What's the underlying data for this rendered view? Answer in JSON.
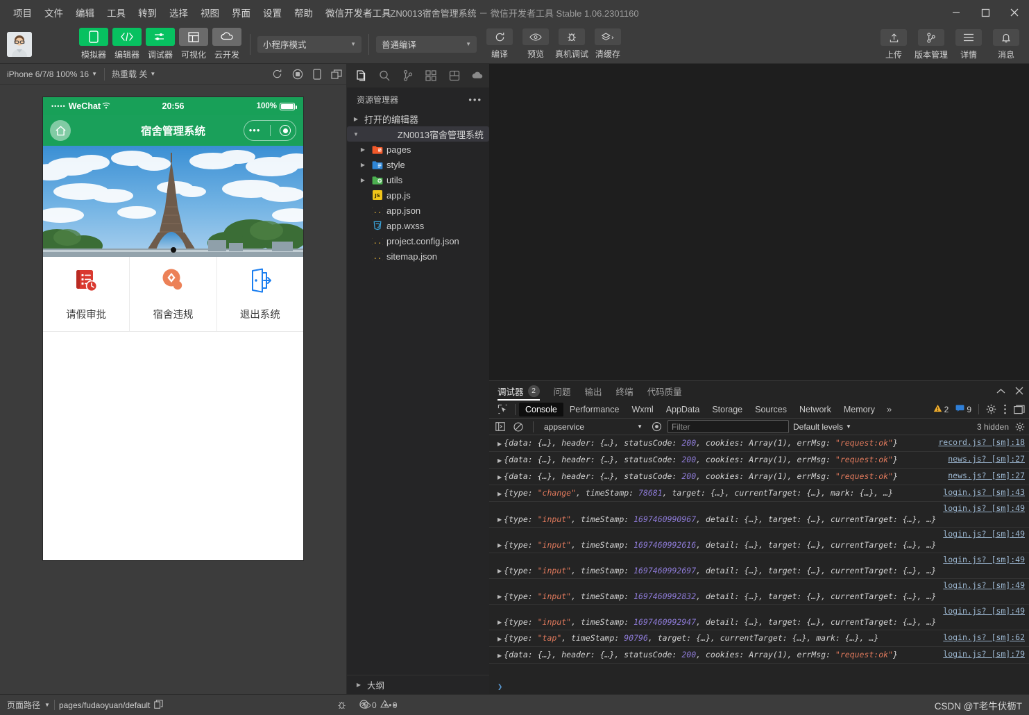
{
  "titlebar": {
    "menus": [
      "项目",
      "文件",
      "编辑",
      "工具",
      "转到",
      "选择",
      "视图",
      "界面",
      "设置",
      "帮助",
      "微信开发者工具"
    ],
    "project_title": "ZN0013宿舍管理系统",
    "title_suffix": "－ 微信开发者工具 Stable 1.06.2301160"
  },
  "toolbar": {
    "mode_buttons": [
      {
        "label": "模拟器",
        "icon": "phone-icon",
        "style": "green"
      },
      {
        "label": "编辑器",
        "icon": "code-icon",
        "style": "green"
      },
      {
        "label": "调试器",
        "icon": "sliders-icon",
        "style": "green"
      },
      {
        "label": "可视化",
        "icon": "layout-icon",
        "style": "grey"
      },
      {
        "label": "云开发",
        "icon": "cloud-icon",
        "style": "grey"
      }
    ],
    "mode_select": "小程序模式",
    "compile_select": "普通编译",
    "action_buttons": [
      {
        "label": "编译",
        "icon": "refresh-icon"
      },
      {
        "label": "预览",
        "icon": "eye-icon"
      },
      {
        "label": "真机调试",
        "icon": "bug-icon"
      },
      {
        "label": "清缓存",
        "icon": "layers-icon"
      }
    ],
    "right_buttons": [
      {
        "label": "上传",
        "icon": "upload-icon"
      },
      {
        "label": "版本管理",
        "icon": "branch-icon"
      },
      {
        "label": "详情",
        "icon": "menu-icon"
      },
      {
        "label": "消息",
        "icon": "bell-icon"
      }
    ]
  },
  "simulator": {
    "device": "iPhone 6/7/8 100% 16",
    "hotreload": "热重载 关",
    "toolbar_icons": [
      "refresh-icon",
      "record-icon",
      "rotate-icon",
      "window-icon"
    ],
    "status": {
      "carrier": "WeChat",
      "signal_dots": "•••••",
      "time": "20:56",
      "battery_pct": "100%"
    },
    "navbar_title": "宿舍管理系统",
    "home_icon": "home-icon",
    "banner_alt": "eiffel-tower-banner",
    "grid": [
      {
        "label": "请假审批",
        "icon": "leave-approval-icon",
        "color": "#d9392f"
      },
      {
        "label": "宿舍违规",
        "icon": "violation-icon",
        "color": "#ec8157"
      },
      {
        "label": "退出系统",
        "icon": "logout-icon",
        "color": "#1a7ef0"
      }
    ]
  },
  "explorer": {
    "activitybar": [
      "files-icon",
      "search-icon",
      "source-control-icon",
      "extensions-icon",
      "debug-icon",
      "cloud-dev-icon"
    ],
    "title": "资源管理器",
    "more": "•••",
    "sections": [
      {
        "label": "打开的编辑器",
        "expanded": false,
        "indent": 0,
        "icon": null
      },
      {
        "label": "ZN0013宿舍管理系统",
        "expanded": true,
        "indent": 0,
        "icon": null,
        "selected": true
      }
    ],
    "files": [
      {
        "label": "pages",
        "icon": "folder-red-icon",
        "type": "folder",
        "expanded": false
      },
      {
        "label": "style",
        "icon": "folder-blue-icon",
        "type": "folder",
        "expanded": false
      },
      {
        "label": "utils",
        "icon": "folder-green-icon",
        "type": "folder",
        "expanded": false
      },
      {
        "label": "app.js",
        "icon": "js-icon",
        "type": "file"
      },
      {
        "label": "app.json",
        "icon": "json-icon",
        "type": "file"
      },
      {
        "label": "app.wxss",
        "icon": "wxss-icon",
        "type": "file"
      },
      {
        "label": "project.config.json",
        "icon": "json-icon",
        "type": "file"
      },
      {
        "label": "sitemap.json",
        "icon": "json-icon",
        "type": "file"
      }
    ],
    "outline": "大纲"
  },
  "devtools": {
    "tabs": [
      {
        "label": "调试器",
        "badge": "2",
        "active": true
      },
      {
        "label": "问题",
        "badge": null,
        "active": false
      },
      {
        "label": "输出",
        "badge": null,
        "active": false
      },
      {
        "label": "终端",
        "badge": null,
        "active": false
      },
      {
        "label": "代码质量",
        "badge": null,
        "active": false
      }
    ],
    "panel_tabs": [
      "Console",
      "Performance",
      "Wxml",
      "AppData",
      "Storage",
      "Sources",
      "Network",
      "Memory"
    ],
    "panel_active": "Console",
    "panel_more": "»",
    "warn_count": "2",
    "info_count": "9",
    "context": "appservice",
    "filter_placeholder": "Filter",
    "levels": "Default levels",
    "hidden": "3 hidden",
    "prompt": "❯",
    "logs": [
      {
        "layout": "single",
        "src": "record.js? [sm]:18",
        "parts": [
          {
            "t": "{data: {…}, header: {…}, statusCode: ",
            "k": "p"
          },
          {
            "t": "200",
            "k": "num"
          },
          {
            "t": ", cookies: Array(1), errMsg: ",
            "k": "p"
          },
          {
            "t": "\"request:ok\"",
            "k": "str"
          },
          {
            "t": "}",
            "k": "p"
          }
        ]
      },
      {
        "layout": "single",
        "src": "news.js? [sm]:27",
        "parts": [
          {
            "t": "{data: {…}, header: {…}, statusCode: ",
            "k": "p"
          },
          {
            "t": "200",
            "k": "num"
          },
          {
            "t": ", cookies: Array(1), errMsg: ",
            "k": "p"
          },
          {
            "t": "\"request:ok\"",
            "k": "str"
          },
          {
            "t": "}",
            "k": "p"
          }
        ]
      },
      {
        "layout": "single",
        "src": "news.js? [sm]:27",
        "parts": [
          {
            "t": "{data: {…}, header: {…}, statusCode: ",
            "k": "p"
          },
          {
            "t": "200",
            "k": "num"
          },
          {
            "t": ", cookies: Array(1), errMsg: ",
            "k": "p"
          },
          {
            "t": "\"request:ok\"",
            "k": "str"
          },
          {
            "t": "}",
            "k": "p"
          }
        ]
      },
      {
        "layout": "single",
        "src": "login.js? [sm]:43",
        "parts": [
          {
            "t": "{type: ",
            "k": "p"
          },
          {
            "t": "\"change\"",
            "k": "str"
          },
          {
            "t": ", timeStamp: ",
            "k": "p"
          },
          {
            "t": "78681",
            "k": "num"
          },
          {
            "t": ", target: {…}, currentTarget: {…}, mark: {…}, …}",
            "k": "p"
          }
        ]
      },
      {
        "layout": "double",
        "src": "login.js? [sm]:49",
        "parts": [
          {
            "t": "{type: ",
            "k": "p"
          },
          {
            "t": "\"input\"",
            "k": "str"
          },
          {
            "t": ", timeStamp: ",
            "k": "p"
          },
          {
            "t": "1697460990967",
            "k": "num"
          },
          {
            "t": ", detail: {…}, target: {…}, currentTarget: {…}, …}",
            "k": "p"
          }
        ]
      },
      {
        "layout": "double",
        "src": "login.js? [sm]:49",
        "parts": [
          {
            "t": "{type: ",
            "k": "p"
          },
          {
            "t": "\"input\"",
            "k": "str"
          },
          {
            "t": ", timeStamp: ",
            "k": "p"
          },
          {
            "t": "1697460992616",
            "k": "num"
          },
          {
            "t": ", detail: {…}, target: {…}, currentTarget: {…}, …}",
            "k": "p"
          }
        ]
      },
      {
        "layout": "double",
        "src": "login.js? [sm]:49",
        "parts": [
          {
            "t": "{type: ",
            "k": "p"
          },
          {
            "t": "\"input\"",
            "k": "str"
          },
          {
            "t": ", timeStamp: ",
            "k": "p"
          },
          {
            "t": "1697460992697",
            "k": "num"
          },
          {
            "t": ", detail: {…}, target: {…}, currentTarget: {…}, …}",
            "k": "p"
          }
        ]
      },
      {
        "layout": "double",
        "src": "login.js? [sm]:49",
        "parts": [
          {
            "t": "{type: ",
            "k": "p"
          },
          {
            "t": "\"input\"",
            "k": "str"
          },
          {
            "t": ", timeStamp: ",
            "k": "p"
          },
          {
            "t": "1697460992832",
            "k": "num"
          },
          {
            "t": ", detail: {…}, target: {…}, currentTarget: {…}, …}",
            "k": "p"
          }
        ]
      },
      {
        "layout": "double",
        "src": "login.js? [sm]:49",
        "parts": [
          {
            "t": "{type: ",
            "k": "p"
          },
          {
            "t": "\"input\"",
            "k": "str"
          },
          {
            "t": ", timeStamp: ",
            "k": "p"
          },
          {
            "t": "1697460992947",
            "k": "num"
          },
          {
            "t": ", detail: {…}, target: {…}, currentTarget: {…}, …}",
            "k": "p"
          }
        ]
      },
      {
        "layout": "single",
        "src": "login.js? [sm]:62",
        "parts": [
          {
            "t": "{type: ",
            "k": "p"
          },
          {
            "t": "\"tap\"",
            "k": "str"
          },
          {
            "t": ", timeStamp: ",
            "k": "p"
          },
          {
            "t": "90796",
            "k": "num"
          },
          {
            "t": ", target: {…}, currentTarget: {…}, mark: {…}, …}",
            "k": "p"
          }
        ]
      },
      {
        "layout": "single",
        "src": "login.js? [sm]:79",
        "parts": [
          {
            "t": "{data: {…}, header: {…}, statusCode: ",
            "k": "p"
          },
          {
            "t": "200",
            "k": "num"
          },
          {
            "t": ", cookies: Array(1), errMsg: ",
            "k": "p"
          },
          {
            "t": "\"request:ok\"",
            "k": "str"
          },
          {
            "t": "}",
            "k": "p"
          }
        ]
      }
    ]
  },
  "statusbar": {
    "page_path_label": "页面路径",
    "page_path_value": "pages/fudaoyuan/default",
    "icons": [
      "bug-icon",
      "eye-icon",
      "ellipsis-icon"
    ],
    "error_count": "0",
    "warning_count": "0",
    "watermark": "CSDN @T老牛伏枥T"
  },
  "colors": {
    "accent_green": "#07c160",
    "wechat_green": "#1aa05a",
    "bg_dark": "#3c3c3c",
    "panel_dark": "#242424",
    "explorer_dark": "#252526"
  }
}
